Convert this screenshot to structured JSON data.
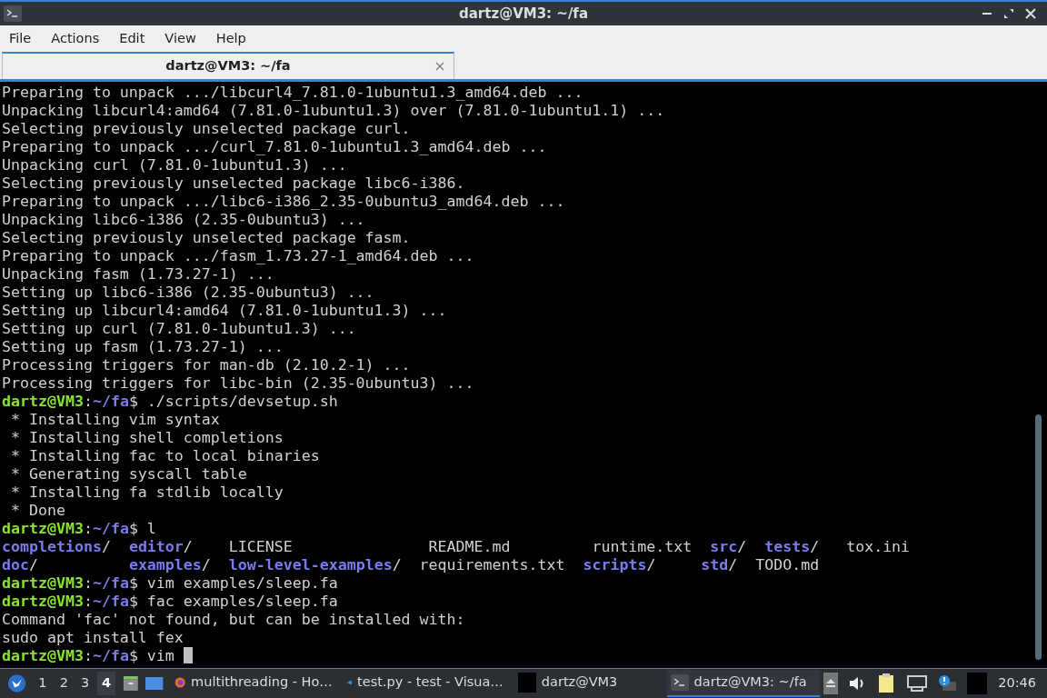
{
  "window": {
    "title": "dartz@VM3: ~/fa"
  },
  "menu": [
    "File",
    "Actions",
    "Edit",
    "View",
    "Help"
  ],
  "tabs": [
    {
      "label": "dartz@VM3: ~/fa",
      "selected": true
    }
  ],
  "terminal": {
    "lines": [
      [
        {
          "kind": "plain",
          "text": "Preparing to unpack .../libcurl4_7.81.0-1ubuntu1.3_amd64.deb ..."
        }
      ],
      [
        {
          "kind": "plain",
          "text": "Unpacking libcurl4:amd64 (7.81.0-1ubuntu1.3) over (7.81.0-1ubuntu1.1) ..."
        }
      ],
      [
        {
          "kind": "plain",
          "text": "Selecting previously unselected package curl."
        }
      ],
      [
        {
          "kind": "plain",
          "text": "Preparing to unpack .../curl_7.81.0-1ubuntu1.3_amd64.deb ..."
        }
      ],
      [
        {
          "kind": "plain",
          "text": "Unpacking curl (7.81.0-1ubuntu1.3) ..."
        }
      ],
      [
        {
          "kind": "plain",
          "text": "Selecting previously unselected package libc6-i386."
        }
      ],
      [
        {
          "kind": "plain",
          "text": "Preparing to unpack .../libc6-i386_2.35-0ubuntu3_amd64.deb ..."
        }
      ],
      [
        {
          "kind": "plain",
          "text": "Unpacking libc6-i386 (2.35-0ubuntu3) ..."
        }
      ],
      [
        {
          "kind": "plain",
          "text": "Selecting previously unselected package fasm."
        }
      ],
      [
        {
          "kind": "plain",
          "text": "Preparing to unpack .../fasm_1.73.27-1_amd64.deb ..."
        }
      ],
      [
        {
          "kind": "plain",
          "text": "Unpacking fasm (1.73.27-1) ..."
        }
      ],
      [
        {
          "kind": "plain",
          "text": "Setting up libc6-i386 (2.35-0ubuntu3) ..."
        }
      ],
      [
        {
          "kind": "plain",
          "text": "Setting up libcurl4:amd64 (7.81.0-1ubuntu1.3) ..."
        }
      ],
      [
        {
          "kind": "plain",
          "text": "Setting up curl (7.81.0-1ubuntu1.3) ..."
        }
      ],
      [
        {
          "kind": "plain",
          "text": "Setting up fasm (1.73.27-1) ..."
        }
      ],
      [
        {
          "kind": "plain",
          "text": "Processing triggers for man-db (2.10.2-1) ..."
        }
      ],
      [
        {
          "kind": "plain",
          "text": "Processing triggers for libc-bin (2.35-0ubuntu3) ..."
        }
      ],
      [
        {
          "kind": "user",
          "text": "dartz@VM3"
        },
        {
          "kind": "plain",
          "text": ":"
        },
        {
          "kind": "path",
          "text": "~/fa"
        },
        {
          "kind": "plain",
          "text": "$ ./scripts/devsetup.sh"
        }
      ],
      [
        {
          "kind": "plain",
          "text": " * Installing vim syntax"
        }
      ],
      [
        {
          "kind": "plain",
          "text": " * Installing shell completions"
        }
      ],
      [
        {
          "kind": "plain",
          "text": " * Installing fac to local binaries"
        }
      ],
      [
        {
          "kind": "plain",
          "text": " * Generating syscall table"
        }
      ],
      [
        {
          "kind": "plain",
          "text": " * Installing fa stdlib locally"
        }
      ],
      [
        {
          "kind": "plain",
          "text": " * Done"
        }
      ],
      [
        {
          "kind": "user",
          "text": "dartz@VM3"
        },
        {
          "kind": "plain",
          "text": ":"
        },
        {
          "kind": "path",
          "text": "~/fa"
        },
        {
          "kind": "plain",
          "text": "$ l"
        }
      ],
      [
        {
          "kind": "dir",
          "text": "completions"
        },
        {
          "kind": "plain",
          "text": "/  "
        },
        {
          "kind": "dir",
          "text": "editor"
        },
        {
          "kind": "plain",
          "text": "/    LICENSE               README.md         runtime.txt  "
        },
        {
          "kind": "dir",
          "text": "src"
        },
        {
          "kind": "plain",
          "text": "/  "
        },
        {
          "kind": "dir",
          "text": "tests"
        },
        {
          "kind": "plain",
          "text": "/   tox.ini"
        }
      ],
      [
        {
          "kind": "dir",
          "text": "doc"
        },
        {
          "kind": "plain",
          "text": "/          "
        },
        {
          "kind": "dir",
          "text": "examples"
        },
        {
          "kind": "plain",
          "text": "/  "
        },
        {
          "kind": "dir",
          "text": "low-level-examples"
        },
        {
          "kind": "plain",
          "text": "/  requirements.txt  "
        },
        {
          "kind": "dir",
          "text": "scripts"
        },
        {
          "kind": "plain",
          "text": "/     "
        },
        {
          "kind": "dir",
          "text": "std"
        },
        {
          "kind": "plain",
          "text": "/  TODO.md"
        }
      ],
      [
        {
          "kind": "user",
          "text": "dartz@VM3"
        },
        {
          "kind": "plain",
          "text": ":"
        },
        {
          "kind": "path",
          "text": "~/fa"
        },
        {
          "kind": "plain",
          "text": "$ vim examples/sleep.fa"
        }
      ],
      [
        {
          "kind": "user",
          "text": "dartz@VM3"
        },
        {
          "kind": "plain",
          "text": ":"
        },
        {
          "kind": "path",
          "text": "~/fa"
        },
        {
          "kind": "plain",
          "text": "$ fac examples/sleep.fa"
        }
      ],
      [
        {
          "kind": "plain",
          "text": "Command 'fac' not found, but can be installed with:"
        }
      ],
      [
        {
          "kind": "plain",
          "text": "sudo apt install fex"
        }
      ],
      [
        {
          "kind": "user",
          "text": "dartz@VM3"
        },
        {
          "kind": "plain",
          "text": ":"
        },
        {
          "kind": "path",
          "text": "~/fa"
        },
        {
          "kind": "plain",
          "text": "$ vim "
        },
        {
          "kind": "cursor"
        }
      ]
    ]
  },
  "taskbar": {
    "workspaces": [
      {
        "label": "1",
        "selected": false
      },
      {
        "label": "2",
        "selected": false
      },
      {
        "label": "3",
        "selected": false
      },
      {
        "label": "4",
        "selected": true
      }
    ],
    "tasks": [
      {
        "kind": "browser",
        "label": "multithreading - Ho…",
        "selected": false
      },
      {
        "kind": "editor",
        "label": "test.py - test - Visua…",
        "selected": false
      },
      {
        "kind": "blank",
        "label": "dartz@VM3",
        "selected": false
      },
      {
        "kind": "terminal",
        "label": "dartz@VM3: ~/fa",
        "selected": true
      }
    ],
    "clock": "20:46"
  }
}
